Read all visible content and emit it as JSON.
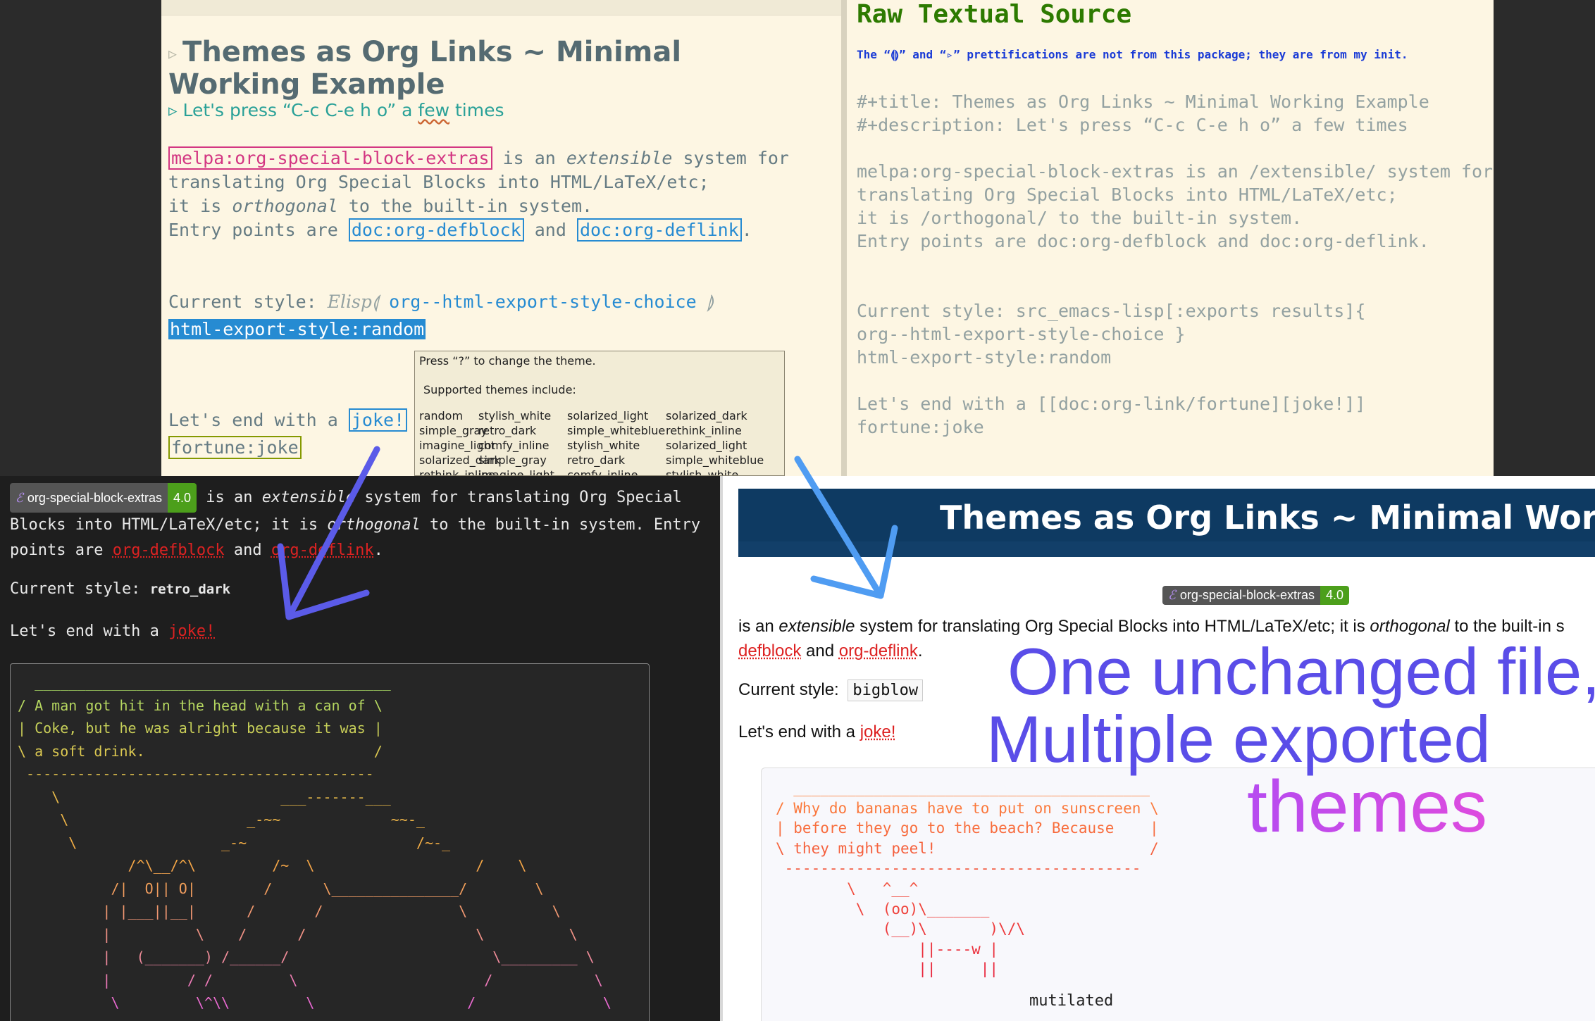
{
  "editor": {
    "title": "Themes as Org Links ~ Minimal Working Example",
    "desc_prefix": "Let's press “C-c C-e h o” a ",
    "desc_wavy": "few",
    "desc_suffix": " times",
    "link_melpa": "melpa:org-special-block-extras",
    "line1_suffix": " is an ",
    "extensible": "extensible",
    "line1_end": " system for",
    "line2": "translating Org Special Blocks into HTML/LaTeX/etc;",
    "line3_prefix": "it is ",
    "orthogonal": "orthogonal",
    "line3_suffix": " to the built-in system.",
    "line4_prefix": "Entry points are ",
    "link_defblock": "doc:org-defblock",
    "and_word": " and ",
    "link_deflink": "doc:org-deflink",
    "period": ".",
    "style_label": "Current style: ",
    "style_script": "Elisp",
    "style_fn": " org--html-export-style-choice ",
    "style_highlight": "html-export-style:random",
    "end_label": "Let's end with a ",
    "link_joke": "joke!",
    "fortune": "fortune:joke"
  },
  "tooltip": {
    "line1": "Press “?” to change the theme.",
    "line2": "Supported themes include:",
    "themes": [
      "random",
      "stylish_white",
      "solarized_light",
      "solarized_dark",
      "simple_gray",
      "retro_dark",
      "simple_whiteblue",
      "rethink_inline",
      "imagine_light",
      "comfy_inline",
      "stylish_white",
      "solarized_light",
      "solarized_dark",
      "simple_gray",
      "retro_dark",
      "simple_whiteblue",
      "rethink_inline",
      "imagine_light",
      "comfy_inline",
      "stylish_white"
    ]
  },
  "raw": {
    "title": "Raw Textual Source",
    "note": "The “⟬⟭” and “▹” prettifications are not from this package; they are from my init.",
    "body": "#+title: Themes as Org Links ~ Minimal Working Example\n#+description: Let's press “C-c C-e h o” a few times\n\nmelpa:org-special-block-extras is an /extensible/ system for\ntranslating Org Special Blocks into HTML/LaTeX/etc;\nit is /orthogonal/ to the built-in system.\nEntry points are doc:org-defblock and doc:org-deflink.\n\n\nCurrent style: src_emacs-lisp[:exports results]{\norg--html-export-style-choice }\nhtml-export-style:random\n\nLet's end with a [[doc:org-link/fortune][joke!]]\nfortune:joke"
  },
  "badge": {
    "name": "org-special-block-extras",
    "version": "4.0"
  },
  "dark_export": {
    "p1_a": " is an ",
    "extensible": "extensible",
    "p1_b": " system for translating Org Special Blocks into HTML/LaTeX/etc; it is ",
    "orthogonal": "orthogonal",
    "p1_c": " to the built-in system. Entry points are ",
    "defblock": "org-defblock",
    "and_word": " and ",
    "deflink": "org-deflink",
    "period": ".",
    "style_label": "Current style: ",
    "style_value": "retro_dark",
    "end_label": "Let's end with a ",
    "joke": "joke!",
    "cow": "  __________________________________________\n/ A man got hit in the head with a can of \\\n| Coke, but he was alright because it was |\n\\ a soft drink.                           /\n -----------------------------------------\n    \\                          ___-------___\n     \\                     _-~~             ~~-_\n      \\                 _-~                    /~-_\n             /^\\__/^\\         /~  \\                   /    \\\n           /|  O|| O|        /      \\_______________/        \\\n          | |___||__|      /       /                \\          \\\n          |          \\    /      /                    \\          \\\n          |   (_______) /______/                        \\_________ \\\n          |         / /         \\                      /            \\\n           \\         \\^\\\\         \\                  /               \\     /"
  },
  "light_export": {
    "title": "Themes as Org Links ~ Minimal Working Example",
    "p1_a": "is an ",
    "extensible": "extensible",
    "p1_b": " system for translating Org Special Blocks into HTML/LaTeX/etc; it is ",
    "orthogonal": "orthogonal",
    "p1_c": " to the built-in s",
    "defblock": "defblock",
    "and_word": " and ",
    "deflink": "org-deflink",
    "period": ".",
    "style_label": "Current style: ",
    "style_value": "bigblow",
    "end_label": "Let's end with a ",
    "joke": "joke!",
    "cow": "  ________________________________________\n/ Why do bananas have to put on sunscreen \\\n| before they go to the beach? Because    |\n\\ they might peel!                        /\n ----------------------------------------\n        \\   ^__^\n         \\  (oo)\\_______\n            (__)\\       )\\/\\\n                ||----w |\n                ||     ||",
    "cow_label": "mutilated"
  },
  "overlay": {
    "line1": "One unchanged file,",
    "line2": "Multiple exported",
    "line3": "themes"
  },
  "colors": {
    "arrow": "#5b5be8",
    "arrow2": "#4f9cf2",
    "header": "#0e3a62"
  }
}
